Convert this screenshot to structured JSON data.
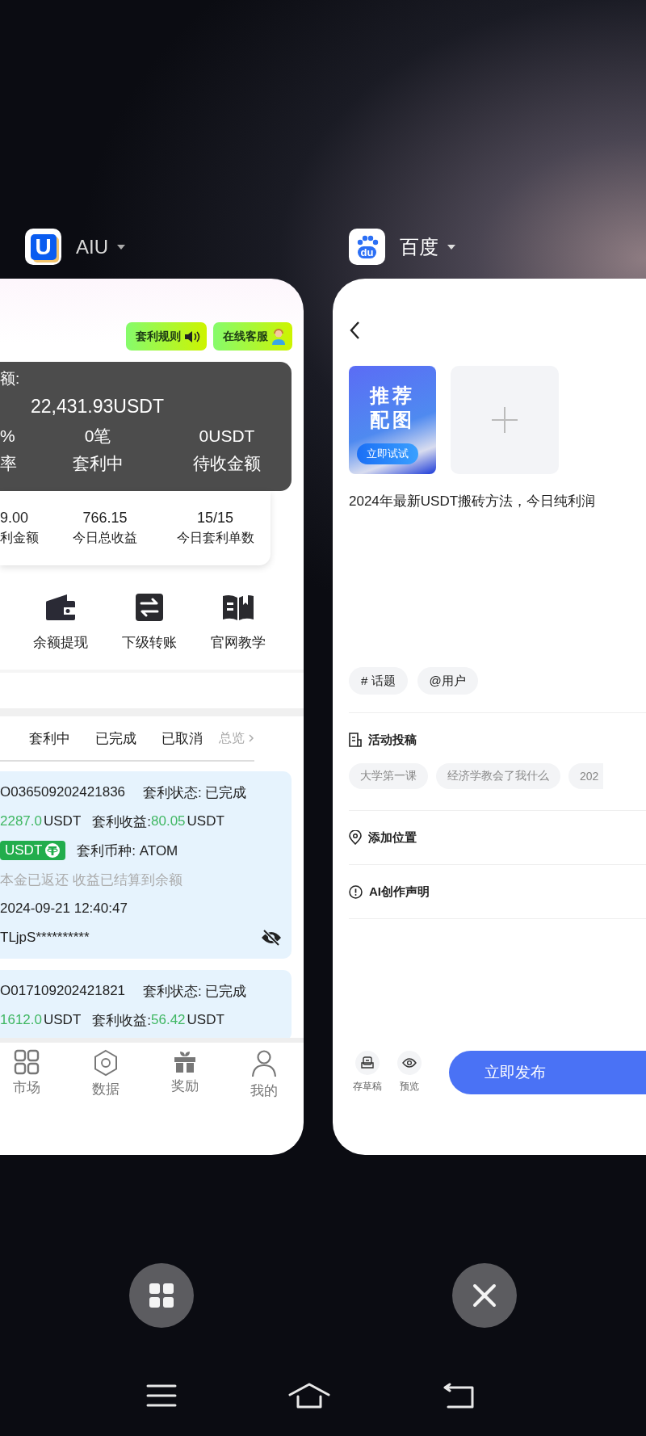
{
  "recents": {
    "left_app": {
      "name": "AIU",
      "logo_text": "U",
      "screen": {
        "top_buttons": [
          {
            "label": "套利规则",
            "kind": "sound"
          },
          {
            "label": "在线客服",
            "kind": "support"
          }
        ],
        "balance": {
          "label": "额:",
          "amount": "22,431.93USDT",
          "stats": [
            {
              "value": "%",
              "label": "率"
            },
            {
              "value": "0笔",
              "label": "套利中"
            },
            {
              "value": "0USDT",
              "label": "待收金额"
            }
          ]
        },
        "today": [
          {
            "value": "9.00",
            "label": "利金额"
          },
          {
            "value": "766.15",
            "label": "今日总收益"
          },
          {
            "value": "15/15",
            "label": "今日套利单数"
          }
        ],
        "actions": [
          {
            "label": "余额提现",
            "kind": "wallet"
          },
          {
            "label": "下级转账",
            "kind": "transfer"
          },
          {
            "label": "官网教学",
            "kind": "book"
          }
        ],
        "tabs": [
          {
            "label": "套利中",
            "selected": false
          },
          {
            "label": "已完成",
            "selected": false
          },
          {
            "label": "已取消",
            "selected": false
          }
        ],
        "overview_link": "总览",
        "orders": [
          {
            "order_no": "O036509202421836",
            "status": "套利状态: 已完成",
            "amount": "2287.0",
            "amount_unit": "USDT",
            "profit_label": "套利收益:",
            "profit": "80.05",
            "profit_unit": "USDT",
            "coin_badge": "USDT",
            "coin": "套利币种: ATOM",
            "note": "本金已返还 收益已结算到余额",
            "time": "2024-09-21 12:40:47",
            "address": "TLjpS**********"
          },
          {
            "order_no": "O017109202421821",
            "status": "套利状态: 已完成",
            "amount": "1612.0",
            "amount_unit": "USDT",
            "profit_label": "套利收益:",
            "profit": "56.42",
            "profit_unit": "USDT"
          }
        ],
        "bottom_nav": [
          {
            "label": "市场",
            "kind": "grid",
            "selected": false
          },
          {
            "label": "数据",
            "kind": "data",
            "selected": false
          },
          {
            "label": "奖励",
            "kind": "gift",
            "selected": false
          },
          {
            "label": "我的",
            "kind": "user",
            "selected": false
          }
        ]
      }
    },
    "right_app": {
      "name": "百度",
      "logo_text": "du",
      "screen": {
        "image_tile": {
          "title_lines": [
            "推荐",
            "配图"
          ],
          "button": "立即试试"
        },
        "post_title": "2024年最新USDT搬砖方法，今日纯利润",
        "chips": [
          "# 话题",
          "@用户"
        ],
        "rows": [
          {
            "label": "活动投稿",
            "kind": "doc"
          },
          {
            "label": "添加位置",
            "kind": "location"
          },
          {
            "label": "AI创作声明",
            "kind": "info"
          }
        ],
        "activity_tags": [
          "大学第一课",
          "经济学教会了我什么",
          "202"
        ],
        "tools": [
          {
            "label": "存草稿",
            "kind": "draft"
          },
          {
            "label": "预览",
            "kind": "preview"
          }
        ],
        "publish_button": "立即发布"
      }
    },
    "dock_buttons": [
      {
        "kind": "grid"
      },
      {
        "kind": "close"
      }
    ],
    "nav_bar": [
      {
        "kind": "menu"
      },
      {
        "kind": "home"
      },
      {
        "kind": "back"
      }
    ]
  }
}
